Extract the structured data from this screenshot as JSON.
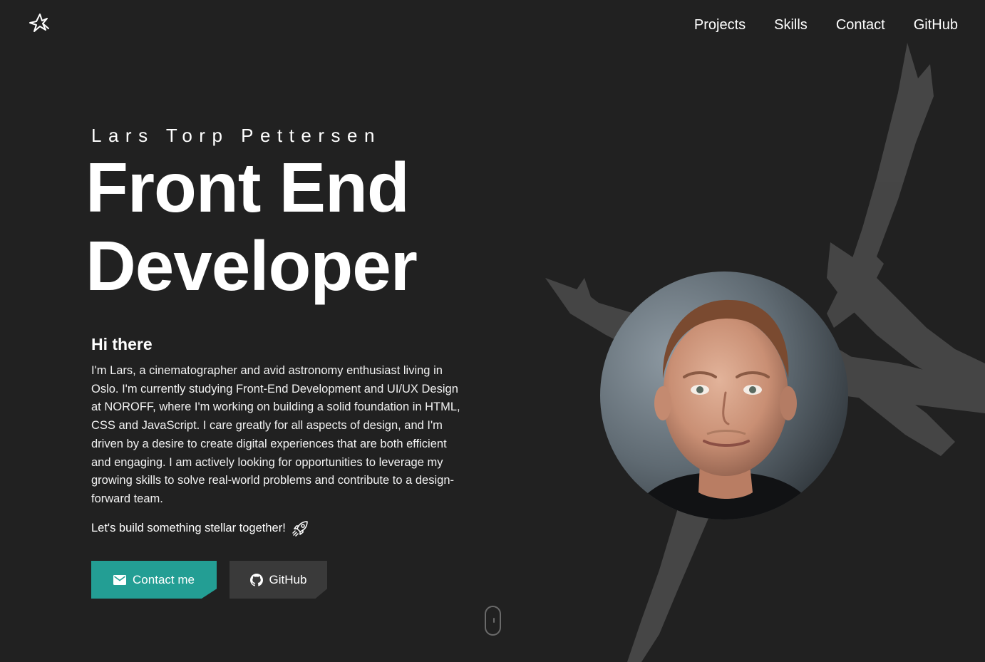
{
  "brand": {
    "logo_icon": "star-signature-logo-icon"
  },
  "nav": {
    "items": [
      {
        "label": "Projects"
      },
      {
        "label": "Skills"
      },
      {
        "label": "Contact"
      },
      {
        "label": "GitHub"
      }
    ]
  },
  "hero": {
    "name": "Lars Torp Pettersen",
    "title_line1": "Front End",
    "title_line2": "Developer",
    "greeting": "Hi there",
    "intro": "I'm Lars, a cinematographer and avid astronomy enthusiast living in Oslo. I'm currently studying Front-End Development and UI/UX Design at NOROFF, where I'm working on building a solid foundation in HTML, CSS and JavaScript. I care greatly for all aspects of design, and I'm driven by a desire to create digital experiences that are both efficient and engaging. I am actively looking for opportunities to leverage my growing skills to solve real-world problems and contribute to a design-forward team.",
    "tagline": "Let's build something stellar together!",
    "tagline_icon": "rocket-icon",
    "buttons": {
      "contact": {
        "label": "Contact me",
        "icon": "mail-icon"
      },
      "github": {
        "label": "GitHub",
        "icon": "github-icon"
      }
    },
    "portrait_icon": "profile-photo"
  },
  "scroll_indicator": {
    "icon": "mouse-scroll-icon"
  },
  "colors": {
    "background": "#212121",
    "accent": "#239e94",
    "secondary_button": "#3a3a3a",
    "background_mark": "#4a4a4a",
    "text": "#ffffff"
  }
}
